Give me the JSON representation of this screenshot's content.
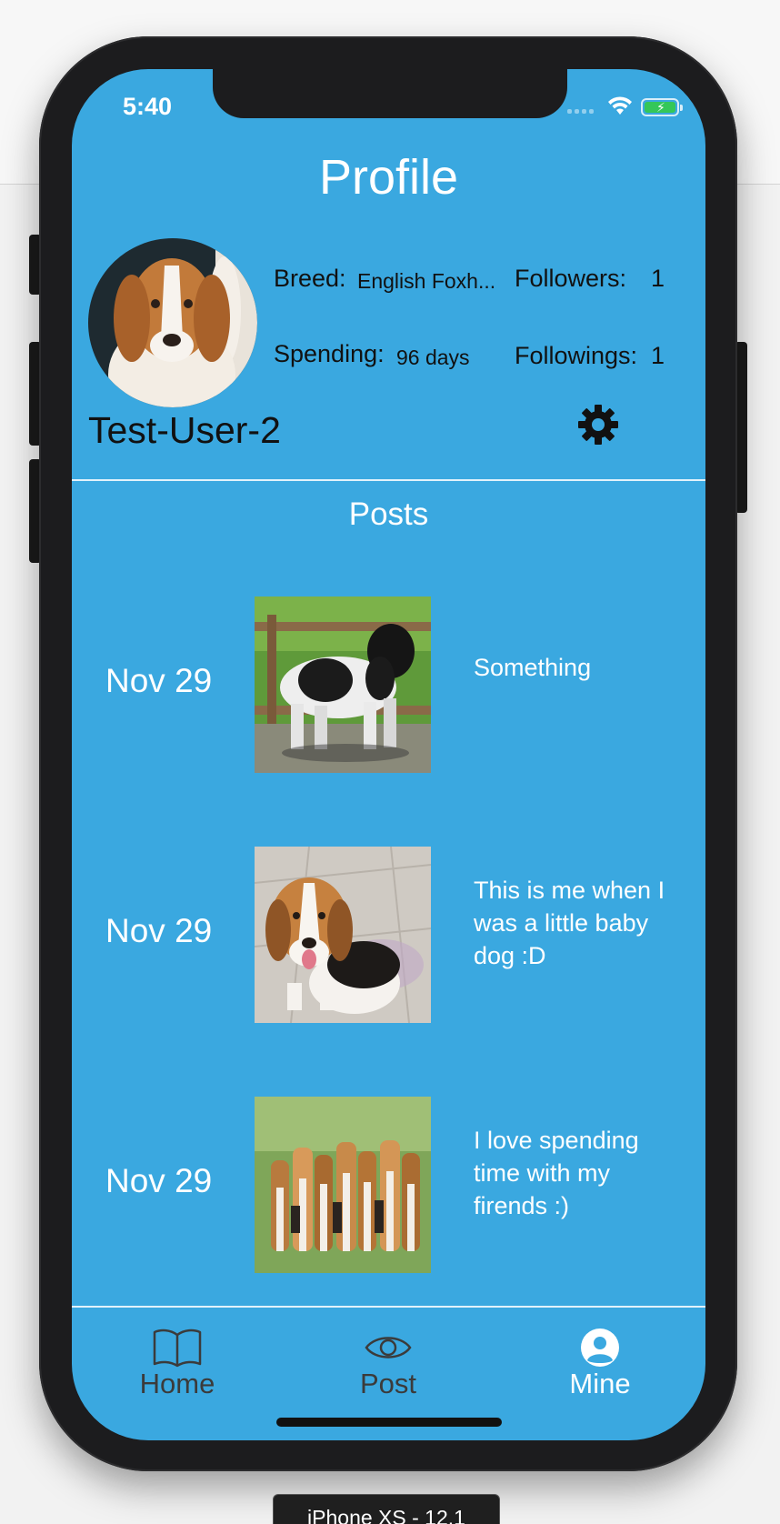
{
  "status_bar": {
    "time": "5:40"
  },
  "header": {
    "title": "Profile"
  },
  "profile": {
    "breed_label": "Breed:",
    "breed_value": "English Foxh...",
    "spending_label": "Spending:",
    "spending_value": "96 days",
    "followers_label": "Followers:",
    "followers_value": "1",
    "followings_label": "Followings:",
    "followings_value": "1",
    "username": "Test-User-2"
  },
  "posts": {
    "title": "Posts",
    "items": [
      {
        "date": "Nov 29",
        "caption": "Something",
        "image": "poodle-photo"
      },
      {
        "date": "Nov 29",
        "caption": "This is me when I was a little baby dog :D",
        "image": "beagle-puppy-photo"
      },
      {
        "date": "Nov 29",
        "caption": "I love spending time with my firends :)",
        "image": "beagle-pack-photo"
      }
    ]
  },
  "tabbar": {
    "tabs": [
      {
        "label": "Home",
        "icon": "book-icon",
        "active": false
      },
      {
        "label": "Post",
        "icon": "eye-icon",
        "active": false
      },
      {
        "label": "Mine",
        "icon": "person-icon",
        "active": true
      }
    ]
  },
  "device_label": "iPhone XS - 12.1",
  "colors": {
    "screen_background": "#3aa8e0",
    "tab_inactive": "#3b3b3b",
    "tab_active": "#ffffff"
  }
}
